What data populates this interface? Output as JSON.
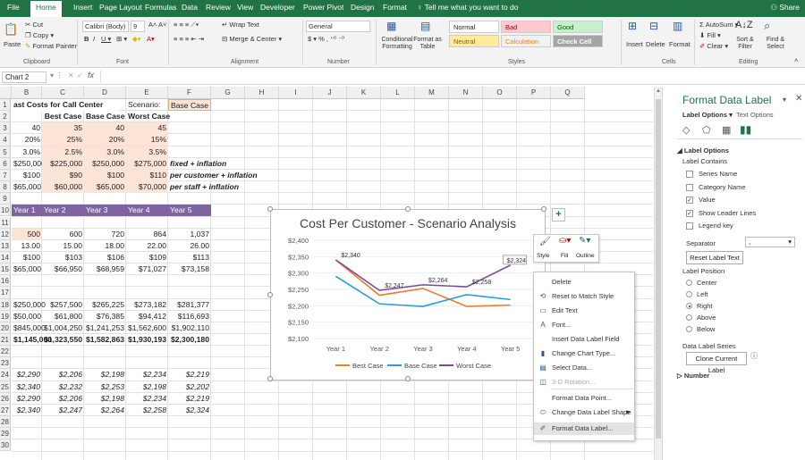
{
  "ribbon_tabs": [
    "File",
    "Home",
    "Insert",
    "Page Layout",
    "Formulas",
    "Data",
    "Review",
    "View",
    "Developer",
    "Power Pivot",
    "Design",
    "Format"
  ],
  "tell_me": "Tell me what you want to do",
  "share": "Share",
  "ribbon": {
    "cut": "Cut",
    "copy": "Copy",
    "paste": "Paste",
    "format_painter": "Format Painter",
    "font_name": "Calibri (Body)",
    "font_size": "9",
    "wrap_text": "Wrap Text",
    "merge_center": "Merge & Center",
    "number_format": "General",
    "conditional_formatting": "Conditional Formatting",
    "format_as_table": "Format as Table",
    "style_normal": "Normal",
    "style_bad": "Bad",
    "style_good": "Good",
    "style_neutral": "Neutral",
    "style_calculation": "Calculation",
    "style_check_cell": "Check Cell",
    "insert": "Insert",
    "delete": "Delete",
    "format": "Format",
    "autosum": "AutoSum",
    "fill": "Fill",
    "clear": "Clear",
    "sort_filter": "Sort & Filter",
    "find_select": "Find & Select",
    "groups": [
      "Clipboard",
      "Font",
      "Alignment",
      "Number",
      "Styles",
      "Cells",
      "Editing"
    ]
  },
  "formula_bar": {
    "name_box": "Chart 2",
    "fx": "fx",
    "value": ""
  },
  "columns": [
    "B",
    "C",
    "D",
    "E",
    "F",
    "G",
    "H",
    "I",
    "J",
    "K",
    "L",
    "M",
    "N",
    "O",
    "P",
    "Q"
  ],
  "rows": [
    "1",
    "2",
    "3",
    "4",
    "5",
    "6",
    "7",
    "8",
    "9",
    "10",
    "11",
    "12",
    "13",
    "14",
    "15",
    "16",
    "17",
    "18",
    "19",
    "20",
    "21",
    "22",
    "23",
    "24",
    "25",
    "26",
    "27",
    "28",
    "29",
    "30"
  ],
  "sheet": {
    "title": "ast Costs for Call Center",
    "scenario_label": "Scenario:",
    "scenario_value": "Base Case",
    "headers": [
      "Best Case",
      "Base Case",
      "Worst Case"
    ],
    "r3": [
      "40",
      "35",
      "40",
      "45"
    ],
    "r4": [
      "20%",
      "25%",
      "20%",
      "15%"
    ],
    "r5": [
      "3.0%",
      "2.5%",
      "3.0%",
      "3.5%"
    ],
    "r6": [
      "$250,000",
      "$225,000",
      "$250,000",
      "$275,000"
    ],
    "r6_note": "fixed + inflation",
    "r7": [
      "$100",
      "$90",
      "$100",
      "$110"
    ],
    "r7_note": "per customer + inflation",
    "r8": [
      "$65,000",
      "$60,000",
      "$65,000",
      "$70,000"
    ],
    "r8_note": "per staff + inflation",
    "years": [
      "Year 1",
      "Year 2",
      "Year 3",
      "Year 4",
      "Year 5"
    ],
    "r12": [
      "500",
      "600",
      "720",
      "864",
      "1,037"
    ],
    "r13": [
      "13.00",
      "15.00",
      "18.00",
      "22.00",
      "26.00"
    ],
    "r14": [
      "$100",
      "$103",
      "$106",
      "$109",
      "$113"
    ],
    "r15": [
      "$65,000",
      "$66,950",
      "$68,959",
      "$71,027",
      "$73,158"
    ],
    "r18": [
      "$250,000",
      "$257,500",
      "$265,225",
      "$273,182",
      "$281,377"
    ],
    "r19": [
      "$50,000",
      "$61,800",
      "$76,385",
      "$94,412",
      "$116,693"
    ],
    "r20": [
      "$845,000",
      "$1,004,250",
      "$1,241,253",
      "$1,562,600",
      "$1,902,110"
    ],
    "r21": [
      "$1,145,000",
      "$1,323,550",
      "$1,582,863",
      "$1,930,193",
      "$2,300,180"
    ],
    "r24": [
      "$2,290",
      "$2,206",
      "$2,198",
      "$2,234",
      "$2,219"
    ],
    "r25": [
      "$2,340",
      "$2,232",
      "$2,253",
      "$2,198",
      "$2,202"
    ],
    "r26": [
      "$2,290",
      "$2,206",
      "$2,198",
      "$2,234",
      "$2,219"
    ],
    "r27": [
      "$2,340",
      "$2,247",
      "$2,264",
      "$2,258",
      "$2,324"
    ]
  },
  "chart_data": {
    "type": "line",
    "title": "Cost Per Customer - Scenario Analysis",
    "categories": [
      "Year 1",
      "Year 2",
      "Year 3",
      "Year 4",
      "Year 5"
    ],
    "ylim": [
      2100,
      2400
    ],
    "yticks": [
      "$2,100",
      "$2,150",
      "$2,200",
      "$2,250",
      "$2,300",
      "$2,350",
      "$2,400"
    ],
    "series": [
      {
        "name": "Best Case",
        "color": "#ED7D31",
        "values": [
          2340,
          2232,
          2253,
          2198,
          2202
        ]
      },
      {
        "name": "Base Case",
        "color": "#2E9BD6",
        "values": [
          2290,
          2206,
          2198,
          2234,
          2219
        ]
      },
      {
        "name": "Worst Case",
        "color": "#7B4A9E",
        "values": [
          2340,
          2247,
          2264,
          2258,
          2324
        ]
      }
    ],
    "data_labels": [
      "$2,340",
      "$2,247",
      "$2,264",
      "$2,258",
      "$2,324"
    ],
    "legend": "bottom"
  },
  "chart_tools": {
    "style": "Style",
    "fill": "Fill",
    "outline": "Outline"
  },
  "context_menu": [
    {
      "label": "Delete",
      "icon": ""
    },
    {
      "label": "Reset to Match Style",
      "icon": "reset-icon"
    },
    {
      "label": "Edit Text",
      "icon": "edit-text-icon"
    },
    {
      "label": "Font...",
      "icon": "font-icon"
    },
    {
      "label": "Insert Data Label Field",
      "icon": ""
    },
    {
      "label": "Change Chart Type...",
      "icon": "chart-type-icon"
    },
    {
      "label": "Select Data...",
      "icon": "select-data-icon"
    },
    {
      "label": "3-D Rotation...",
      "icon": "rotation-icon"
    },
    {
      "label": "Format Data Point...",
      "icon": ""
    },
    {
      "label": "Change Data Label Shape",
      "icon": "shape-icon"
    },
    {
      "label": "Format Data Label...",
      "icon": "format-label-icon"
    }
  ],
  "pane": {
    "title": "Format Data Label",
    "tab_label_options": "Label Options",
    "tab_text_options": "Text Options",
    "section_label_options": "Label Options",
    "label_contains": "Label Contains",
    "checks": [
      {
        "label": "Series Name",
        "checked": false
      },
      {
        "label": "Category Name",
        "checked": false
      },
      {
        "label": "Value",
        "checked": true
      },
      {
        "label": "Show Leader Lines",
        "checked": true
      },
      {
        "label": "Legend key",
        "checked": false
      }
    ],
    "separator": "Separator",
    "separator_value": ",",
    "reset_label_text": "Reset Label Text",
    "label_position": "Label Position",
    "positions": [
      {
        "label": "Center",
        "on": false
      },
      {
        "label": "Left",
        "on": false
      },
      {
        "label": "Right",
        "on": true
      },
      {
        "label": "Above",
        "on": false
      },
      {
        "label": "Below",
        "on": false
      }
    ],
    "data_label_series": "Data Label Series",
    "clone_current_label": "Clone Current Label",
    "number_section": "Number"
  }
}
